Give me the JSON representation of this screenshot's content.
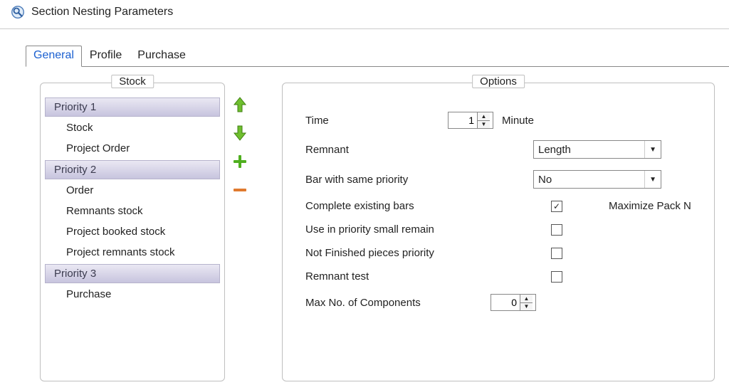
{
  "window": {
    "title": "Section Nesting Parameters"
  },
  "tabs": [
    {
      "label": "General",
      "selected": true
    },
    {
      "label": "Profile",
      "selected": false
    },
    {
      "label": "Purchase",
      "selected": false
    }
  ],
  "stock": {
    "legend": "Stock",
    "groups": [
      {
        "header": "Priority 1",
        "items": [
          "Stock",
          "Project Order"
        ]
      },
      {
        "header": "Priority 2",
        "items": [
          "Order",
          "Remnants stock",
          "Project booked stock",
          "Project remnants stock"
        ]
      },
      {
        "header": "Priority 3",
        "items": [
          "Purchase"
        ]
      }
    ]
  },
  "options": {
    "legend": "Options",
    "time": {
      "label": "Time",
      "value": "1",
      "unit": "Minute"
    },
    "remnant": {
      "label": "Remnant",
      "value": "Length"
    },
    "bar_matching": {
      "label": "Bar with same priority",
      "value": "No"
    },
    "complete_bars": {
      "label": "Complete existing bars",
      "checked": true,
      "extra": "Maximize Pack N"
    },
    "use_small_remain": {
      "label": "Use in priority small remain",
      "checked": false
    },
    "not_finished": {
      "label": "Not Finished pieces priority",
      "checked": false
    },
    "remnant_test": {
      "label": "Remnant test",
      "checked": false
    },
    "max_components": {
      "label": "Max No. of Components",
      "value": "0"
    }
  },
  "icons": {
    "up": "arrow-up-icon",
    "down": "arrow-down-icon",
    "plus": "plus-icon",
    "minus": "minus-icon"
  }
}
